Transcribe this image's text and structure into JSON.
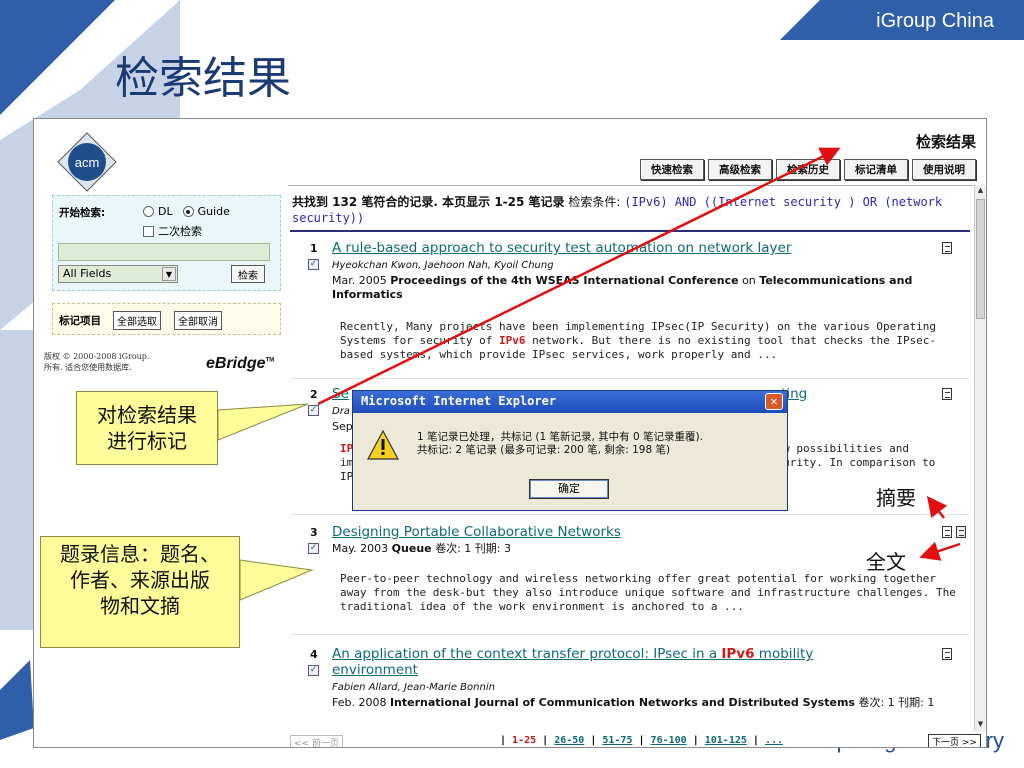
{
  "slide": {
    "title": "检索结果",
    "brand": "iGroup China",
    "footer": "Association for Computing Machinery"
  },
  "colors": {
    "slide_blue": "#1a3a73",
    "link": "#0a6a78",
    "highlight": "#d01818",
    "query": "#2c27b0"
  },
  "app": {
    "heading": "检索结果",
    "logo_text": "acm",
    "nav": [
      "快速检索",
      "高级检索",
      "检索历史",
      "标记清单",
      "使用说明"
    ]
  },
  "search": {
    "label": "开始检索:",
    "radio_dl": "DL",
    "radio_guide": "Guide",
    "radio_selected": "Guide",
    "secondary": "二次检索",
    "input_value": "",
    "field_select": "All Fields",
    "go": "检索"
  },
  "mark": {
    "label": "标记项目",
    "select_all": "全部选取",
    "deselect_all": "全部取消"
  },
  "copyright": {
    "line1": "版权 © 2000-2008 iGroup.",
    "line2": "所有. 适合您使用数据库."
  },
  "ebridge": "eBridge",
  "summary": {
    "prefix": "共找到 132 笔符合的记录. 本页显示 1-25 笔记录",
    "cond_label": "检索条件:",
    "query": "(IPv6) AND ((Internet security ) OR (network security))"
  },
  "records": [
    {
      "num": "1",
      "title": "A rule-based approach to security test automation on network layer",
      "authors": "Hyeokchan Kwon, Jaehoon Nah, Kyoil Chung",
      "date": "Mar. 2005",
      "source": "Proceedings of the 4th WSEAS International Conference",
      "source_on": "on",
      "source2": "Telecommunications and Informatics",
      "abstract_pre": "Recently, Many projects have been implementing IPsec(IP Security) on the various Operating Systems for security of ",
      "abstract_hl": "IPv6",
      "abstract_post": " network. But there is no existing tool that checks the IPsec-based systems, which provide IPsec services, work properly and ..."
    },
    {
      "num": "2",
      "title_start": "Se",
      "title_end": "sting",
      "authors_start": "Dra",
      "date_start": "Sep",
      "abs_a": "IP",
      "abs_b": "im",
      "abs_c": "IP·",
      "abs_end1": "ny new possibilities and",
      "abs_end2": "d security. In comparison to"
    },
    {
      "num": "3",
      "title": "Designing Portable Collaborative Networks",
      "date": "May. 2003",
      "source": "Queue",
      "vol": "卷次: 1 刊期: 3",
      "abstract": "Peer-to-peer technology and wireless networking offer great potential for working together away from the desk-but they also introduce unique software and infrastructure challenges. The traditional idea of the work environment is anchored to a ..."
    },
    {
      "num": "4",
      "title_pre": "An application of the context transfer protocol: IPsec in a ",
      "title_hl": "IPv6",
      "title_post": " mobility environment",
      "authors": "Fabien Allard, Jean-Marie Bonnin",
      "date": "Feb. 2008",
      "source": "International Journal of Communication Networks and Distributed Systems",
      "vol": "卷次: 1 刊期: 1"
    }
  ],
  "pager": {
    "prev": "<< 前一页",
    "current": "1-25",
    "pages": [
      "26-50",
      "51-75",
      "76-100",
      "101-125",
      "..."
    ],
    "next": "下一页 >>"
  },
  "dialog": {
    "title": "Microsoft Internet Explorer",
    "line1": "1 笔记录已处理，共标记 (1 笔新记录, 其中有 0 笔记录重覆).",
    "line2": "共标记: 2 笔记录 (最多可记录: 200 笔, 剩余: 198 笔)",
    "ok": "确定"
  },
  "annotations": {
    "mark_callout_1": "对检索结果",
    "mark_callout_2": "进行标记",
    "info_callout_1": "题录信息：题名、",
    "info_callout_2": "作者、来源出版",
    "info_callout_3": "物和文摘",
    "abstract": "摘要",
    "fulltext": "全文"
  }
}
